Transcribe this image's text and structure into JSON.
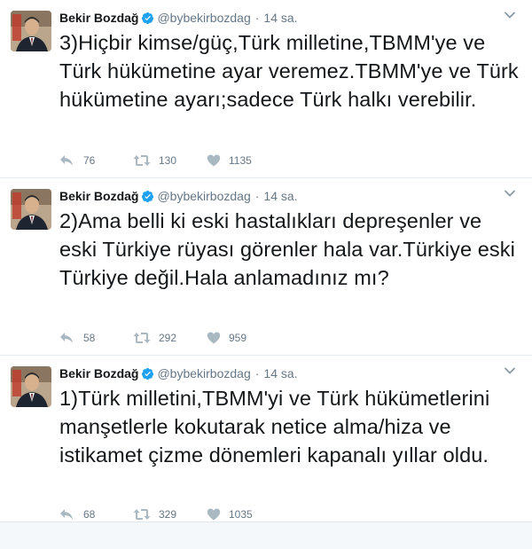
{
  "tweets": [
    {
      "name": "Bekir Bozdağ",
      "handle": "@bybekirbozdag",
      "separator": "·",
      "time": "14 sa.",
      "text": "3)Hiçbir kimse/güç,Türk milletine,TBMM'ye ve Türk hükümetine ayar veremez.TBMM'ye ve Türk hükümetine ayarı;sadece Türk halkı verebilir.",
      "replies": "76",
      "retweets": "130",
      "likes": "1135"
    },
    {
      "name": "Bekir Bozdağ",
      "handle": "@bybekirbozdag",
      "separator": "·",
      "time": "14 sa.",
      "text": "2)Ama belli ki eski hastalıkları depreşenler ve eski Türkiye rüyası görenler hala var.Türkiye eski Türkiye değil.Hala anlamadınız mı?",
      "replies": "58",
      "retweets": "292",
      "likes": "959"
    },
    {
      "name": "Bekir Bozdağ",
      "handle": "@bybekirbozdag",
      "separator": "·",
      "time": "14 sa.",
      "text": "1)Türk milletini,TBMM'yi ve Türk hükümetlerini manşetlerle kokutarak netice alma/hiza ve istikamet çizme dönemleri kapanalı yıllar oldu.",
      "replies": "68",
      "retweets": "329",
      "likes": "1035"
    }
  ],
  "colors": {
    "verified": "#1da1f2",
    "muted": "#657786",
    "text": "#14171a",
    "action_icon": "#aab8c2"
  },
  "icons": {
    "avatar": "profile-photo",
    "verified": "verified-badge-icon",
    "menu": "chevron-down-icon",
    "reply": "reply-icon",
    "retweet": "retweet-icon",
    "like": "heart-icon"
  }
}
